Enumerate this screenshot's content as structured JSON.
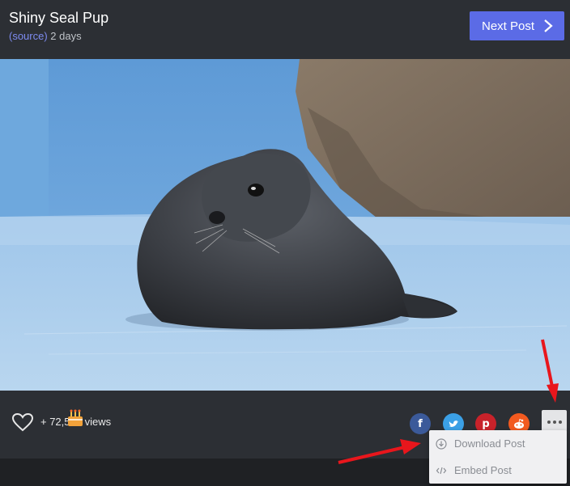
{
  "post": {
    "title": "Shiny Seal Pup",
    "source_label": "(source)",
    "age": " 2 days",
    "next_label": "Next Post"
  },
  "stats": {
    "views_text": "+ 72,534 views"
  },
  "share": {
    "facebook": "f",
    "twitter": "t",
    "pinterest": "p",
    "reddit": "r"
  },
  "menu": {
    "items": [
      {
        "label": "Download Post",
        "icon": "download-icon"
      },
      {
        "label": "Embed Post",
        "icon": "code-icon"
      }
    ]
  },
  "colors": {
    "accent": "#5b6be6",
    "arrow": "#e8161c"
  }
}
